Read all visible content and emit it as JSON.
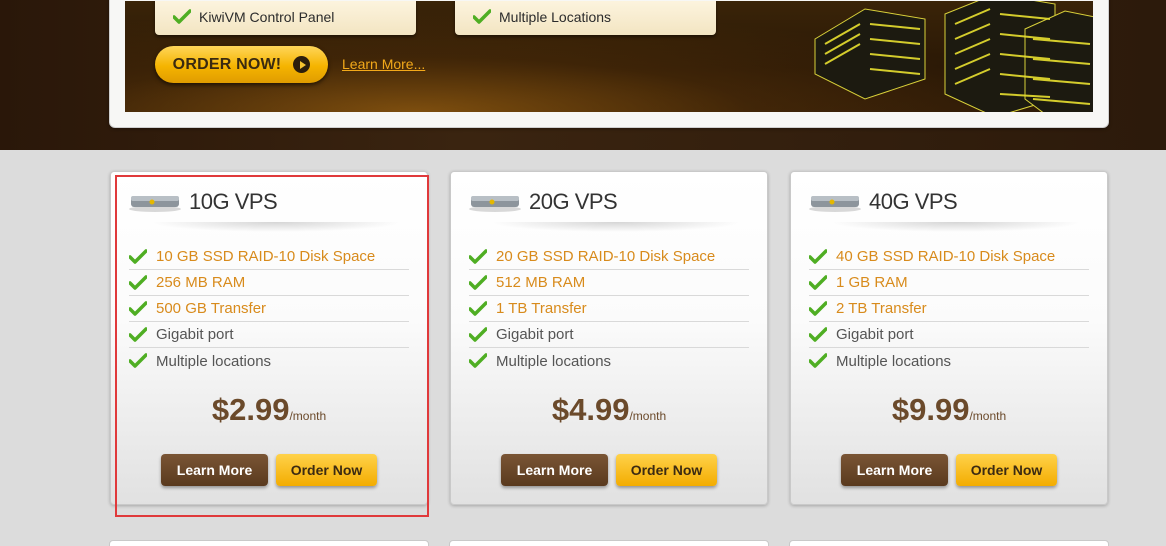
{
  "hero": {
    "features": [
      {
        "label": "KiwiVM Control Panel"
      },
      {
        "label": "Multiple Locations"
      }
    ],
    "order_label": "ORDER NOW!",
    "learn_more_label": "Learn More..."
  },
  "plans": [
    {
      "title": "10G VPS",
      "features": [
        "10 GB SSD RAID-10 Disk Space",
        "256 MB RAM",
        "500 GB Transfer",
        "Gigabit port",
        "Multiple locations"
      ],
      "price": "$2.99",
      "per": "/month",
      "learn_label": "Learn More",
      "order_label": "Order Now"
    },
    {
      "title": "20G VPS",
      "features": [
        "20 GB SSD RAID-10 Disk Space",
        "512 MB RAM",
        "1 TB Transfer",
        "Gigabit port",
        "Multiple locations"
      ],
      "price": "$4.99",
      "per": "/month",
      "learn_label": "Learn More",
      "order_label": "Order Now"
    },
    {
      "title": "40G VPS",
      "features": [
        "40 GB SSD RAID-10 Disk Space",
        "1 GB RAM",
        "2 TB Transfer",
        "Gigabit port",
        "Multiple locations"
      ],
      "price": "$9.99",
      "per": "/month",
      "learn_label": "Learn More",
      "order_label": "Order Now"
    }
  ],
  "colors": {
    "accent_orange": "#d88b1c",
    "price_brown": "#6b4a2b",
    "button_brown": "#5a3a1e",
    "button_gold": "#f3ac00",
    "selection_red": "#e0393b"
  },
  "icons": [
    "checkmark-icon",
    "disk-drive-icon",
    "play-arrow-icon",
    "server-rack-graphic"
  ]
}
